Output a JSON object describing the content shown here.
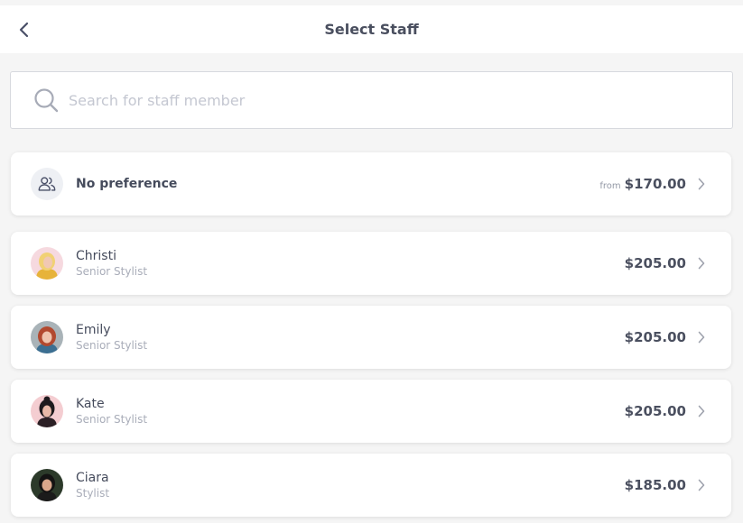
{
  "header": {
    "title": "Select Staff"
  },
  "search": {
    "placeholder": "Search for staff member"
  },
  "no_preference": {
    "label": "No preference",
    "from_label": "from",
    "price": "$170.00"
  },
  "staff": [
    {
      "name": "Christi",
      "role": "Senior Stylist",
      "price": "$205.00"
    },
    {
      "name": "Emily",
      "role": "Senior Stylist",
      "price": "$205.00"
    },
    {
      "name": "Kate",
      "role": "Senior Stylist",
      "price": "$205.00"
    },
    {
      "name": "Ciara",
      "role": "Stylist",
      "price": "$185.00"
    }
  ]
}
